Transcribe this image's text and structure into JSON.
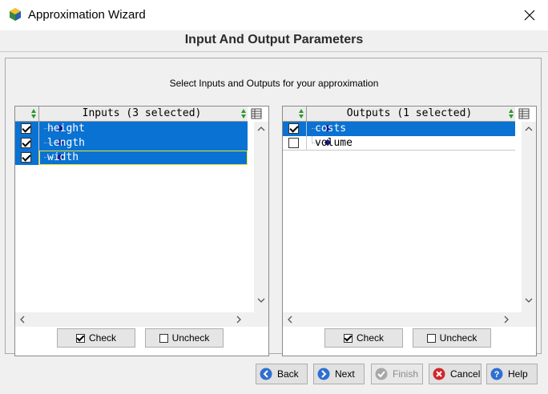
{
  "window": {
    "title": "Approximation Wizard"
  },
  "page": {
    "header": "Input And Output Parameters",
    "instruction": "Select Inputs and Outputs for your approximation"
  },
  "inputs": {
    "header": "Inputs (3 selected)",
    "rows": [
      {
        "label": "height",
        "checked": true,
        "selected": true
      },
      {
        "label": "length",
        "checked": true,
        "selected": true
      },
      {
        "label": "width",
        "checked": true,
        "selected": true
      }
    ],
    "check_label": "Check",
    "uncheck_label": "Uncheck"
  },
  "outputs": {
    "header": "Outputs (1 selected)",
    "rows": [
      {
        "label": "costs",
        "checked": true,
        "selected": true
      },
      {
        "label": "volume",
        "checked": false,
        "selected": false
      }
    ],
    "check_label": "Check",
    "uncheck_label": "Uncheck"
  },
  "footer": {
    "back": "Back",
    "next": "Next",
    "finish": "Finish",
    "cancel": "Cancel",
    "help": "Help"
  },
  "colors": {
    "selection": "#0a72d2",
    "focus_border": "#e8e82a",
    "nav_blue": "#2f6fd0",
    "cancel_red": "#d0282a"
  }
}
